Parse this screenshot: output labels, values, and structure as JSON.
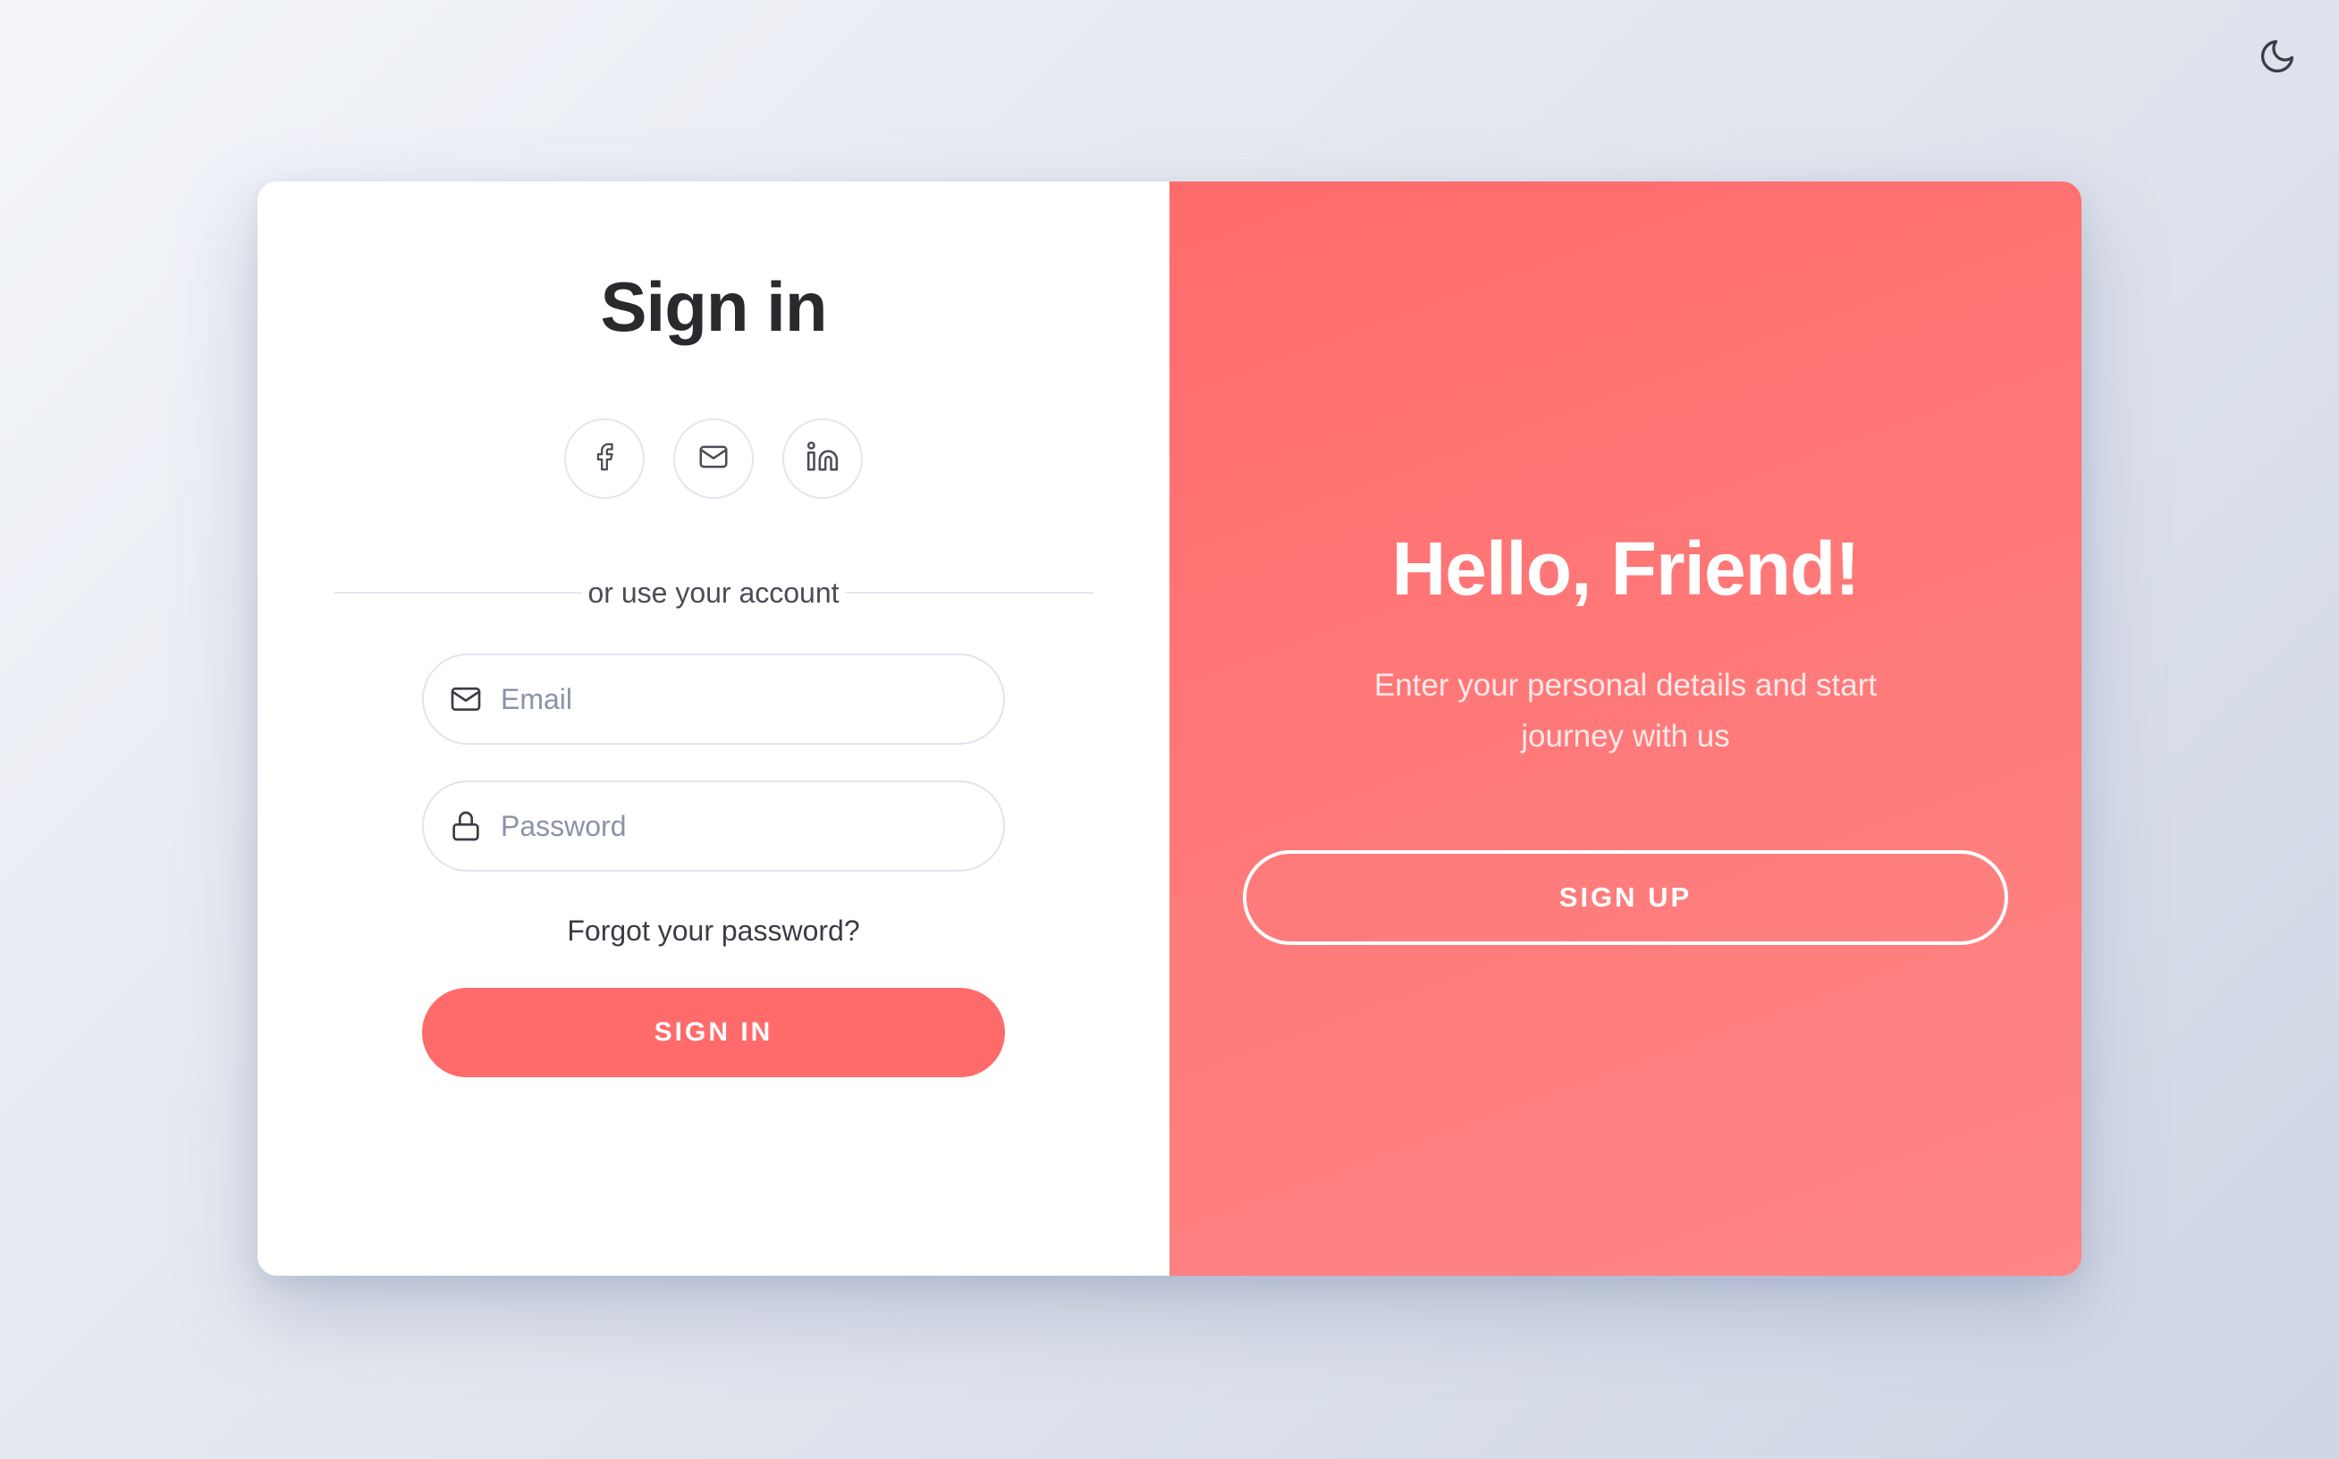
{
  "theme_toggle": {
    "icon": "moon-icon"
  },
  "signin": {
    "title": "Sign in",
    "social": [
      {
        "icon": "facebook-icon"
      },
      {
        "icon": "mail-icon"
      },
      {
        "icon": "linkedin-icon"
      }
    ],
    "divider_text": "or use your account",
    "email": {
      "placeholder": "Email",
      "value": ""
    },
    "password": {
      "placeholder": "Password",
      "value": ""
    },
    "forgot_label": "Forgot your password?",
    "button_label": "SIGN IN"
  },
  "overlay": {
    "title": "Hello, Friend!",
    "description": "Enter your personal details and start journey with us",
    "button_label": "SIGN UP"
  },
  "colors": {
    "accent": "#ff6b6b",
    "text_dark": "#2a2a2e",
    "placeholder": "#8c93a8"
  }
}
